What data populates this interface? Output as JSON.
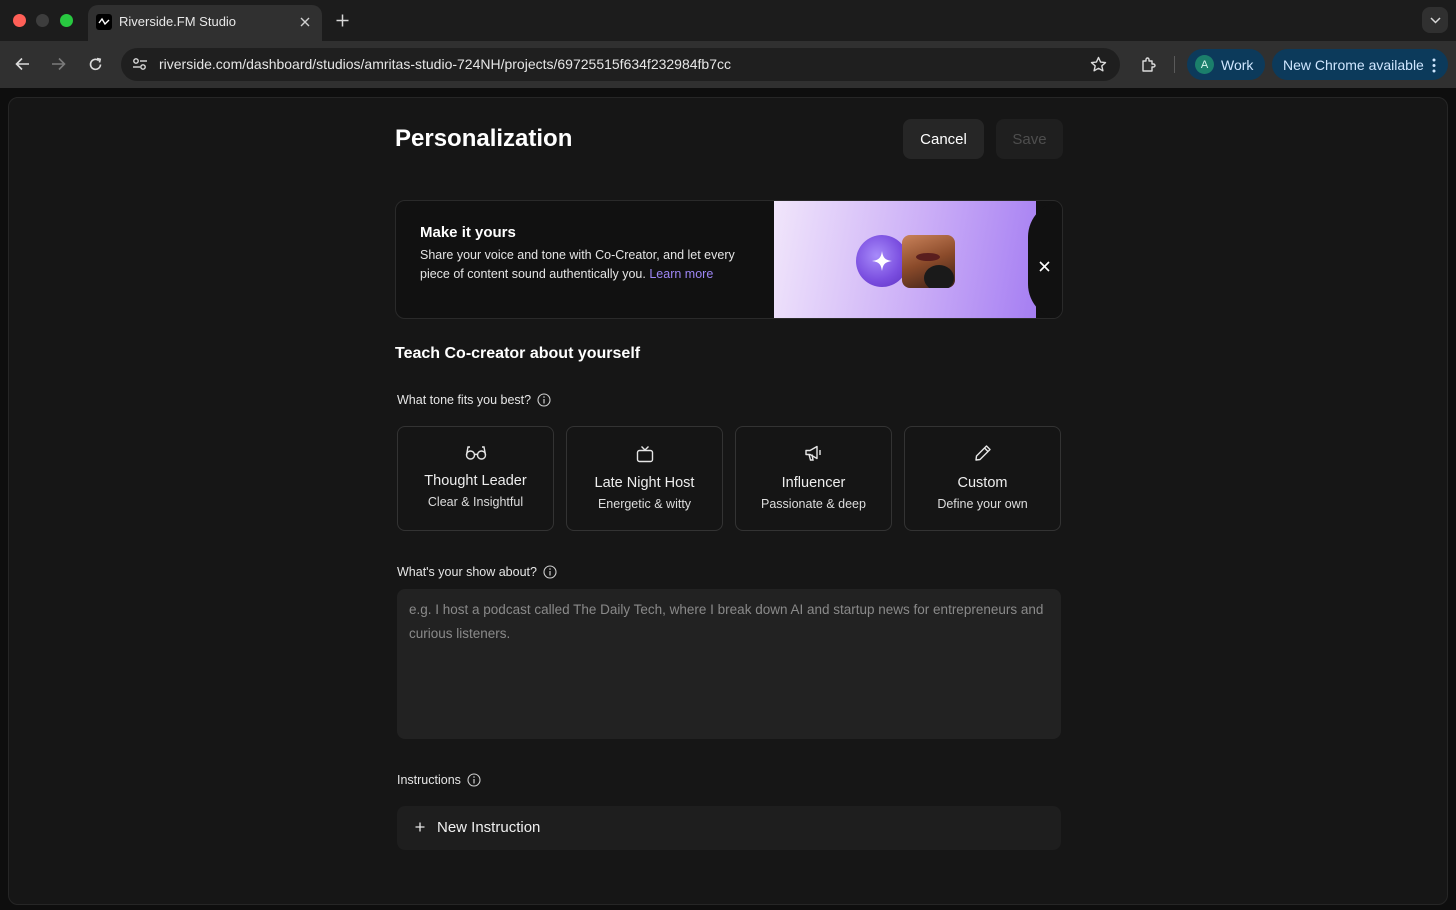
{
  "browser": {
    "tab_title": "Riverside.FM Studio",
    "url": "riverside.com/dashboard/studios/amritas-studio-724NH/projects/69725515f634f232984fb7cc",
    "profile_initial": "A",
    "profile_name": "Work",
    "update_label": "New Chrome available"
  },
  "header": {
    "title": "Personalization",
    "cancel_label": "Cancel",
    "save_label": "Save"
  },
  "banner": {
    "title": "Make it yours",
    "text": "Share your voice and tone with Co-Creator, and let every piece of content sound authentically you.",
    "link_label": "Learn more"
  },
  "section": {
    "title": "Teach Co-creator about yourself"
  },
  "tone": {
    "label": "What tone fits you best?",
    "options": [
      {
        "name": "Thought Leader",
        "desc": "Clear & Insightful",
        "icon": "glasses-icon"
      },
      {
        "name": "Late Night Host",
        "desc": "Energetic & witty",
        "icon": "tv-icon"
      },
      {
        "name": "Influencer",
        "desc": "Passionate & deep",
        "icon": "megaphone-icon"
      },
      {
        "name": "Custom",
        "desc": "Define your own",
        "icon": "pencil-icon"
      }
    ]
  },
  "show": {
    "label": "What's your show about?",
    "value": "",
    "placeholder": "e.g. I host a podcast called The Daily Tech, where I break down AI and startup news for entrepreneurs and curious listeners."
  },
  "instructions": {
    "label": "Instructions",
    "new_label": "New Instruction"
  },
  "colors": {
    "page_bg": "#161616",
    "accent_link": "#9d86f5",
    "chrome_chip": "#0c3a5b"
  }
}
